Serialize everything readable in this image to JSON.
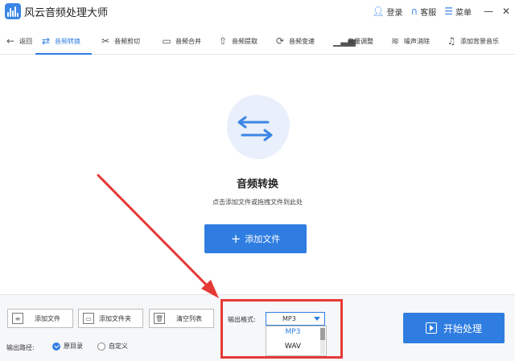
{
  "app": {
    "title": "风云音频处理大师",
    "login": "登录",
    "support": "客服",
    "menu": "菜单"
  },
  "nav": {
    "back": "返回",
    "items": [
      {
        "label": "音频转换",
        "icon": "convert-icon",
        "active": true
      },
      {
        "label": "音频剪切",
        "icon": "scissors-icon"
      },
      {
        "label": "音频合并",
        "icon": "merge-icon"
      },
      {
        "label": "音频提取",
        "icon": "upload-icon"
      },
      {
        "label": "音频变速",
        "icon": "speed-icon"
      },
      {
        "label": "音量调整",
        "icon": "volume-bars-icon"
      },
      {
        "label": "噪声消除",
        "icon": "noise-icon"
      },
      {
        "label": "添加背景音乐",
        "icon": "music-note-icon"
      }
    ]
  },
  "main": {
    "title": "音频转换",
    "subtitle": "点击添加文件或拖拽文件到此处",
    "add_button": "添加文件"
  },
  "bottom": {
    "add_file": "添加文件",
    "add_folder": "添加文件夹",
    "clear_list": "清空列表",
    "output_path_label": "输出路径:",
    "path_options": [
      {
        "label": "原目录",
        "selected": true
      },
      {
        "label": "自定义",
        "selected": false
      }
    ],
    "format_label": "输出格式:",
    "format_value": "MP3",
    "format_options": [
      "MP3",
      "WAV"
    ],
    "start_button": "开始处理"
  },
  "colors": {
    "accent": "#2f7de1",
    "annotation": "#e53935"
  }
}
